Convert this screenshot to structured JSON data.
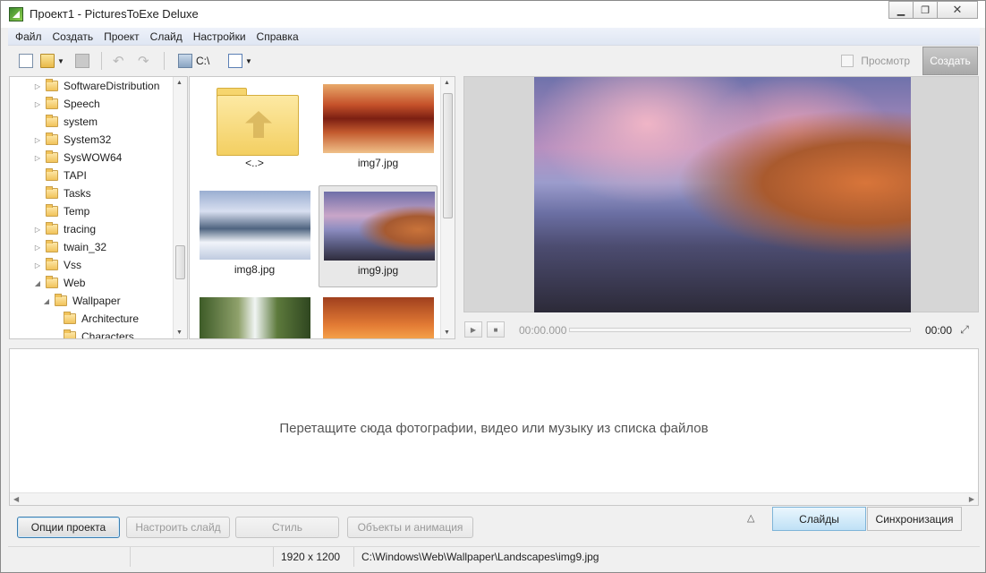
{
  "window": {
    "title": "Проект1 - PicturesToExe Deluxe"
  },
  "menu": [
    "Файл",
    "Создать",
    "Проект",
    "Слайд",
    "Настройки",
    "Справка"
  ],
  "toolbar": {
    "drive_label": "C:\\",
    "preview_label": "Просмотр",
    "create_label": "Создать"
  },
  "tree": {
    "items": [
      {
        "label": "SoftwareDistribution",
        "expander": "▷"
      },
      {
        "label": "Speech",
        "expander": "▷"
      },
      {
        "label": "system",
        "expander": ""
      },
      {
        "label": "System32",
        "expander": "▷"
      },
      {
        "label": "SysWOW64",
        "expander": "▷"
      },
      {
        "label": "TAPI",
        "expander": ""
      },
      {
        "label": "Tasks",
        "expander": ""
      },
      {
        "label": "Temp",
        "expander": ""
      },
      {
        "label": "tracing",
        "expander": "▷"
      },
      {
        "label": "twain_32",
        "expander": "▷"
      },
      {
        "label": "Vss",
        "expander": "▷"
      },
      {
        "label": "Web",
        "expander": "◢"
      },
      {
        "label": "Wallpaper",
        "expander": "◢"
      },
      {
        "label": "Architecture",
        "expander": ""
      },
      {
        "label": "Characters",
        "expander": ""
      }
    ]
  },
  "thumbs": [
    {
      "label": "<..>",
      "kind": "folder-up"
    },
    {
      "label": "img7.jpg",
      "kind": "canyon"
    },
    {
      "label": "img8.jpg",
      "kind": "ice"
    },
    {
      "label": "img9.jpg",
      "kind": "coast",
      "selected": true
    },
    {
      "label": "",
      "kind": "falls"
    },
    {
      "label": "",
      "kind": "arch"
    }
  ],
  "player": {
    "time_current": "00:00.000",
    "time_total": "00:00"
  },
  "timeline": {
    "hint": "Перетащите сюда фотографии, видео или музыку из списка файлов"
  },
  "buttons": {
    "project_options": "Опции проекта",
    "customize_slide": "Настроить слайд",
    "style": "Стиль",
    "objects_animation": "Объекты и анимация"
  },
  "tabs": {
    "slides": "Слайды",
    "sync": "Синхронизация"
  },
  "status": {
    "resolution": "1920 x 1200",
    "path": "C:\\Windows\\Web\\Wallpaper\\Landscapes\\img9.jpg"
  }
}
